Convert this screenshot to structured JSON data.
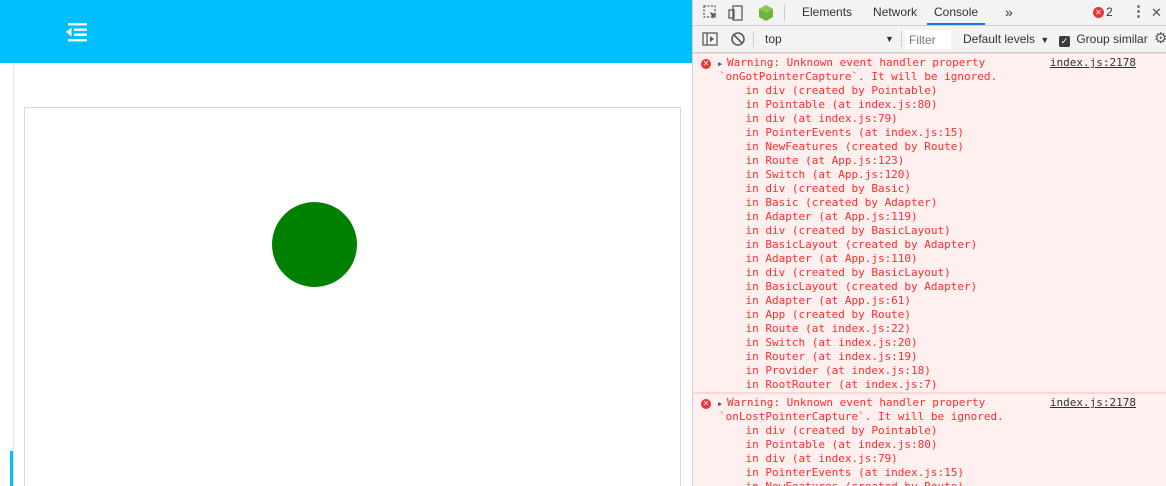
{
  "colors": {
    "app_header": "#00bfff",
    "circle": "#008000",
    "accent_bar": "#00bfff",
    "error_text": "#fe2d2d",
    "error_bg": "#fff0f0"
  },
  "app": {
    "menu_icon": "menu-fold-icon"
  },
  "devtools": {
    "tabs": [
      "Elements",
      "Network",
      "Console"
    ],
    "active_tab": "Console",
    "more_tabs_icon": "»",
    "error_count": "2",
    "context_value": "top",
    "filter_placeholder": "Filter",
    "levels_label": "Default levels",
    "group_similar_label": "Group similar",
    "group_similar_checked": true
  },
  "console": {
    "messages": [
      {
        "source": "index.js:2178",
        "lines": [
          "Warning: Unknown event handler property",
          "`onGotPointerCapture`. It will be ignored.",
          "    in div (created by Pointable)",
          "    in Pointable (at index.js:80)",
          "    in div (at index.js:79)",
          "    in PointerEvents (at index.js:15)",
          "    in NewFeatures (created by Route)",
          "    in Route (at App.js:123)",
          "    in Switch (at App.js:120)",
          "    in div (created by Basic)",
          "    in Basic (created by Adapter)",
          "    in Adapter (at App.js:119)",
          "    in div (created by BasicLayout)",
          "    in BasicLayout (created by Adapter)",
          "    in Adapter (at App.js:110)",
          "    in div (created by BasicLayout)",
          "    in BasicLayout (created by Adapter)",
          "    in Adapter (at App.js:61)",
          "    in App (created by Route)",
          "    in Route (at index.js:22)",
          "    in Switch (at index.js:20)",
          "    in Router (at index.js:19)",
          "    in Provider (at index.js:18)",
          "    in RootRouter (at index.js:7)"
        ]
      },
      {
        "source": "index.js:2178",
        "lines": [
          "Warning: Unknown event handler property",
          "`onLostPointerCapture`. It will be ignored.",
          "    in div (created by Pointable)",
          "    in Pointable (at index.js:80)",
          "    in div (at index.js:79)",
          "    in PointerEvents (at index.js:15)",
          "    in NewFeatures (created by Route)"
        ]
      }
    ]
  }
}
